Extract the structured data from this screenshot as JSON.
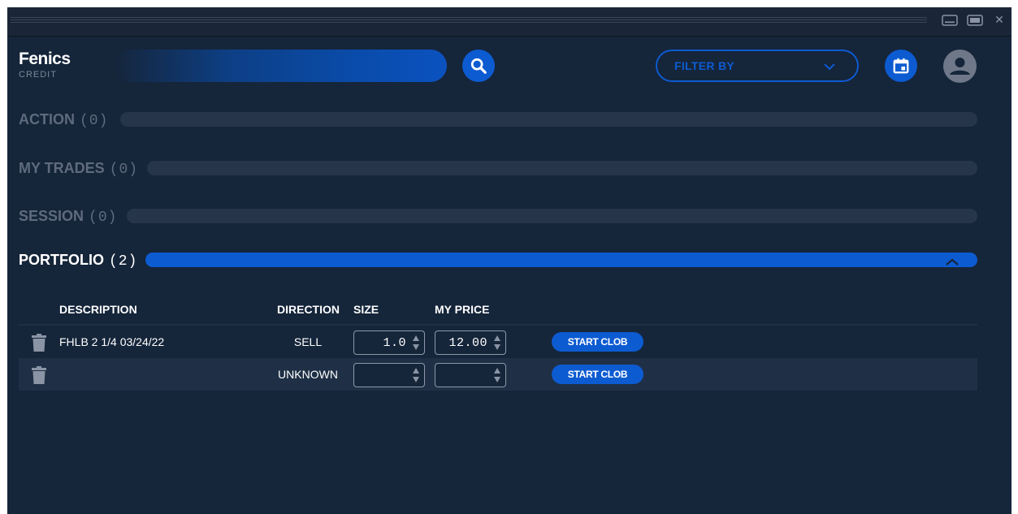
{
  "brand": {
    "name": "Fenics",
    "sub": "CREDIT"
  },
  "header": {
    "search_placeholder": "",
    "filter_label": "FILTER BY"
  },
  "sections": [
    {
      "name": "ACTION",
      "count": "(0)"
    },
    {
      "name": "MY TRADES",
      "count": "(0)"
    },
    {
      "name": "SESSION",
      "count": "(0)"
    },
    {
      "name": "PORTFOLIO",
      "count": "(2)"
    }
  ],
  "table": {
    "columns": {
      "description": "DESCRIPTION",
      "direction": "DIRECTION",
      "size": "SIZE",
      "my_price": "MY PRICE"
    },
    "rows": [
      {
        "description": "FHLB 2 1/4 03/24/22",
        "direction": "SELL",
        "size": "1.0",
        "my_price": "12.00",
        "action": "START CLOB"
      },
      {
        "description": "",
        "direction": "UNKNOWN",
        "size": "",
        "my_price": "",
        "action": "START CLOB"
      }
    ]
  },
  "colors": {
    "accent": "#0d5bd1",
    "background": "#15253a",
    "bar": "#263549",
    "row_alt": "#1f3046"
  },
  "icons": [
    "minimize-icon",
    "maximize-icon",
    "close-icon",
    "search-icon",
    "chevron-down-icon",
    "calendar-icon",
    "user-icon",
    "chevron-up-icon",
    "trash-icon"
  ]
}
